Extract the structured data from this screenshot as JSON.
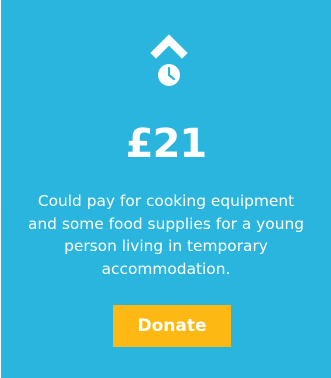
{
  "card": {
    "icon": "chevron-up-clock-icon",
    "amount": "£21",
    "description": "Could pay for cooking equipment and some food supplies for a young person living in temporary accommodation.",
    "button_label": "Donate"
  },
  "colors": {
    "card_background": "#29b5de",
    "text": "#ffffff",
    "button_background": "#fdb813"
  }
}
